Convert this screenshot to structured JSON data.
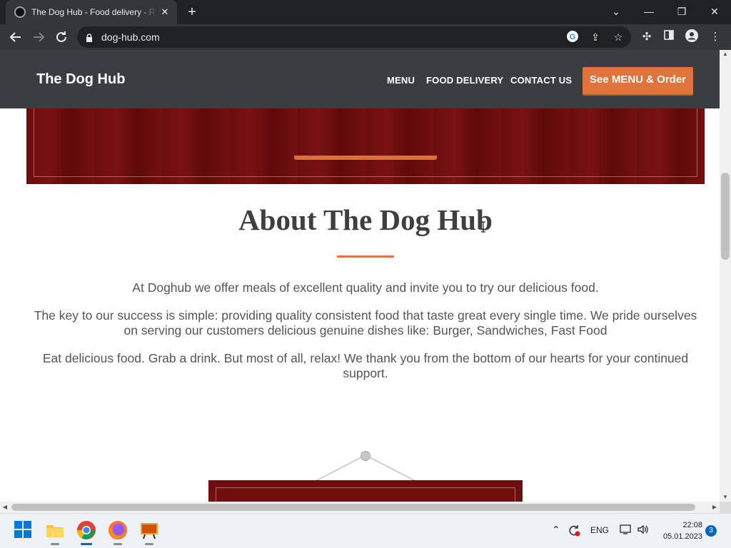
{
  "browser": {
    "tab_title": "The Dog Hub - Food delivery - R",
    "tab_close": "✕",
    "new_tab": "+",
    "url": "dog-hub.com",
    "window_controls": {
      "dropdown": "⌄",
      "minimize": "—",
      "restore": "❐",
      "close": "✕"
    }
  },
  "site": {
    "brand": "The Dog Hub",
    "nav": [
      "MENU",
      "FOOD DELIVERY",
      "CONTACT US"
    ],
    "cta": "See MENU & Order"
  },
  "about": {
    "title": "About The Dog Hub",
    "paragraphs": [
      "At Doghub we offer meals of excellent quality and invite you to try our delicious food.",
      "The key to our success is simple: providing quality consistent food that taste great every single time. We pride ourselves on serving our customers delicious genuine dishes like: Burger, Sandwiches, Fast Food",
      "Eat delicious food. Grab a drink. But most of all, relax! We thank you from the bottom of our hearts for your continued support."
    ]
  },
  "taskbar": {
    "language": "ENG",
    "time": "22:08",
    "date": "05.01.2023",
    "notifications": "3"
  },
  "colors": {
    "accent": "#e0743c",
    "header_bg": "#3a3d41",
    "maroon": "#6e0e0e"
  }
}
